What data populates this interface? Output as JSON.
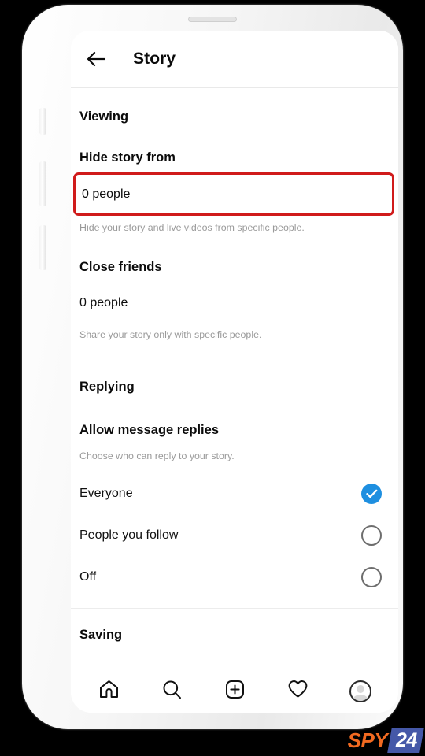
{
  "header": {
    "back_icon": "arrow-left-icon",
    "title": "Story"
  },
  "sections": {
    "viewing": {
      "title": "Viewing",
      "hide_story": {
        "label": "Hide story from",
        "value": "0 people",
        "helper": "Hide your story and live videos from specific people.",
        "highlighted": true,
        "highlight_color": "#d01b1b"
      },
      "close_friends": {
        "label": "Close friends",
        "value": "0 people",
        "helper": "Share your story only with specific people."
      }
    },
    "replying": {
      "title": "Replying",
      "allow_replies": {
        "label": "Allow message replies",
        "helper": "Choose who can reply to your story.",
        "selected": "Everyone",
        "accent_color": "#1e8fe0",
        "options": [
          {
            "label": "Everyone",
            "checked": true
          },
          {
            "label": "People you follow",
            "checked": false
          },
          {
            "label": "Off",
            "checked": false
          }
        ]
      }
    },
    "saving": {
      "title": "Saving"
    }
  },
  "bottom_nav": {
    "items": [
      {
        "icon": "home-icon",
        "label": "Home"
      },
      {
        "icon": "search-icon",
        "label": "Search"
      },
      {
        "icon": "add-post-icon",
        "label": "Create"
      },
      {
        "icon": "heart-icon",
        "label": "Activity"
      },
      {
        "icon": "profile-avatar-icon",
        "label": "Profile"
      }
    ]
  },
  "watermark": {
    "primary": "SPY",
    "secondary": "24",
    "primary_color": "#f26a21",
    "secondary_bg": "#4558a8"
  }
}
